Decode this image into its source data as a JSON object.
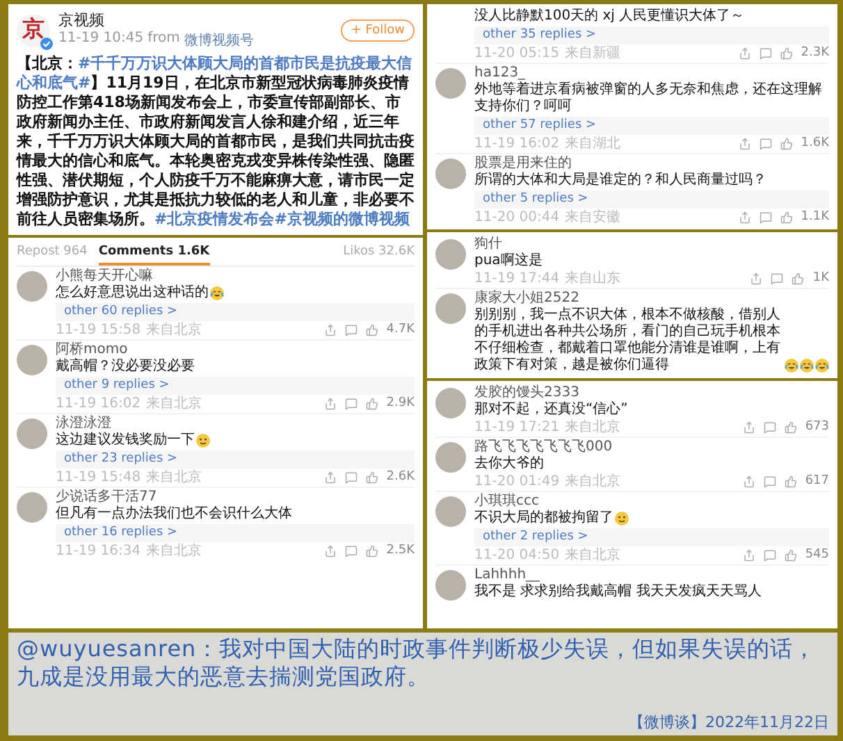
{
  "post": {
    "logo_text": "京",
    "author": "京视频",
    "verified": true,
    "time": "11-19 10:45",
    "source_prefix": "from",
    "source": "微博视频号",
    "follow_button": "+ Follow",
    "body": [
      {
        "kind": "text",
        "text": "【北京："
      },
      {
        "kind": "hashtag",
        "text": "#千千万万识大体顾大局的首都市民是抗疫最大信心和底气#"
      },
      {
        "kind": "text",
        "text": "】11月19日，在北京市新型冠状病毒肺炎疫情防控工作第418场新闻发布会上，市委宣传部副部长、市政府新闻办主任、市政府新闻发言人徐和建介绍，近三年来，千千万万识大体顾大局的首都市民，是我们共同抗击疫情最大的信心和底气。本轮奥密克戎变异株传染性强、隐匿性强、潜伏期短，个人防疫千万不能麻痹大意，请市民一定增强防护意识，尤其是抵抗力较低的老人和儿童，非必要不前往人员密集场所。"
      },
      {
        "kind": "hashtag",
        "text": "#北京疫情发布会#"
      },
      {
        "kind": "link",
        "text": "京视频的微博视频"
      }
    ]
  },
  "tabs": [
    {
      "label": "Repost 964",
      "selected": false
    },
    {
      "label": "Comments 1.6K",
      "selected": true
    },
    {
      "label": "Likos 32.6K",
      "selected": false
    }
  ],
  "left_comments": [
    {
      "name": "小熊每天开心嘛",
      "lines": [
        "怎么好意思说出这种话的"
      ],
      "emoji": [
        {
          "kind": "laugh-cry"
        }
      ],
      "replies": "other 60 replies >",
      "time": "11-19 15:58",
      "location": "来自北京",
      "likes": "4.7K"
    },
    {
      "name": "阿桥momo",
      "lines": [
        "戴高帽？没必要没必要"
      ],
      "replies": "other 9 replies >",
      "time": "11-19 16:02",
      "location": "来自北京",
      "likes": "2.9K"
    },
    {
      "name": "泳澄泳澄",
      "lines": [
        "这边建议发钱奖励一下"
      ],
      "emoji": [
        {
          "kind": "smile"
        }
      ],
      "replies": "other 23 replies >",
      "time": "11-19 15:48",
      "location": "来自北京",
      "likes": "2.6K"
    },
    {
      "name": "少说话多干活77",
      "lines": [
        "但凡有一点办法我们也不会识什么大体"
      ],
      "replies": "other 16 replies >",
      "time": "11-19 16:34",
      "location": "来自北京",
      "likes": "2.5K"
    }
  ],
  "right_panels": [
    {
      "comments": [
        {
          "lines": [
            "没人比静默100天的 xj 人民更懂识大体了～"
          ],
          "replies": "other 35 replies >",
          "time": "11-20 05:15",
          "location": "来自新疆",
          "likes": "2.3K"
        },
        {
          "name": "ha123_",
          "lines": [
            "外地等着进京看病被弹窗的人多无奈和焦虑，还在这理解支持你们？呵呵"
          ],
          "replies": "other 57 replies >",
          "time": "11-19 16:02",
          "location": "来自湖北",
          "likes": "1.6K"
        },
        {
          "name": "股票是用来住的",
          "lines": [
            "所谓的大体和大局是谁定的？和人民商量过吗？"
          ],
          "replies": "other 5 replies >",
          "time": "11-20 00:44",
          "location": "来自安徽",
          "likes": "1.1K"
        }
      ]
    },
    {
      "comments": [
        {
          "name": "狗什",
          "lines": [
            "pua啊这是"
          ],
          "time": "11-19 17:44",
          "location": "来自山东",
          "likes": "1K"
        },
        {
          "name": "康家大小姐2522",
          "lines": [
            "别别别，我一点不识大体，根本不做核酸，借别人的手机进出各种共公场所，看门的自己玩手机根本不仔细检查，都戴着口罩他能分清谁是谁啊，上有政策下有对策，越是被你们逼得"
          ],
          "emoji": [
            {
              "kind": "laugh-cry"
            },
            {
              "kind": "laugh-cry"
            },
            {
              "kind": "laugh-cry"
            }
          ]
        }
      ]
    },
    {
      "comments": [
        {
          "name": "发胶的馒头2333",
          "lines": [
            "那对不起，还真没“信心”"
          ],
          "time": "11-19 17:21",
          "location": "来自北京",
          "likes": "673"
        },
        {
          "name": "路飞飞飞飞飞飞飞000",
          "lines": [
            "去你大爷的"
          ],
          "time": "11-20 01:49",
          "location": "来自北京",
          "likes": "617"
        },
        {
          "name": "小琪琪ccc",
          "lines": [
            "不识大局的都被拘留了"
          ],
          "emoji": [
            {
              "kind": "smile"
            }
          ],
          "replies": "other 2 replies >",
          "time": "11-20 04:50",
          "location": "来自北京",
          "likes": "545"
        },
        {
          "name": "Lahhhh__",
          "lines": [
            "我不是 求求别给我戴高帽 我天天发疯天天骂人"
          ]
        }
      ]
    }
  ],
  "caption": {
    "text": "@wuyuesanren：我对中国大陆的时政事件判断极少失误，但如果失误的话，九成是没用最大的恶意去揣测党国政府。",
    "credit": "【微博谈】2022年11月22日"
  }
}
